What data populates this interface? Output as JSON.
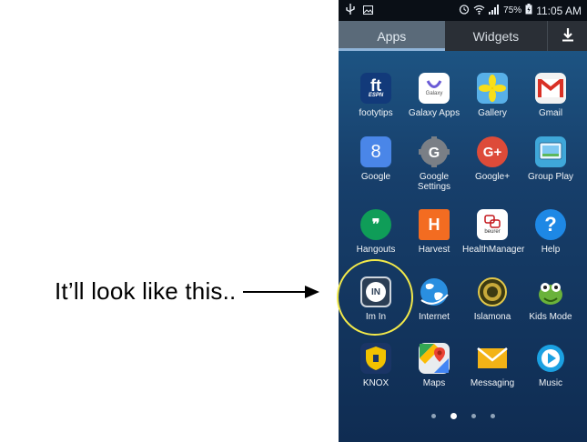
{
  "caption": "It’ll look like this..",
  "status": {
    "battery": "75%",
    "time": "11:05 AM"
  },
  "tabs": {
    "apps": "Apps",
    "widgets": "Widgets"
  },
  "apps": [
    {
      "label": "footytips",
      "icon": "footytips-icon"
    },
    {
      "label": "Galaxy Apps",
      "icon": "galaxy-apps-icon"
    },
    {
      "label": "Gallery",
      "icon": "gallery-icon"
    },
    {
      "label": "Gmail",
      "icon": "gmail-icon"
    },
    {
      "label": "Google",
      "icon": "google-icon"
    },
    {
      "label": "Google Settings",
      "icon": "google-settings-icon"
    },
    {
      "label": "Google+",
      "icon": "google-plus-icon"
    },
    {
      "label": "Group Play",
      "icon": "group-play-icon"
    },
    {
      "label": "Hangouts",
      "icon": "hangouts-icon"
    },
    {
      "label": "Harvest",
      "icon": "harvest-icon"
    },
    {
      "label": "HealthManager",
      "icon": "health-manager-icon"
    },
    {
      "label": "Help",
      "icon": "help-icon"
    },
    {
      "label": "Im In",
      "icon": "im-in-icon"
    },
    {
      "label": "Internet",
      "icon": "internet-icon"
    },
    {
      "label": "Islamona",
      "icon": "islamona-icon"
    },
    {
      "label": "Kids Mode",
      "icon": "kids-mode-icon"
    },
    {
      "label": "KNOX",
      "icon": "knox-icon"
    },
    {
      "label": "Maps",
      "icon": "maps-icon"
    },
    {
      "label": "Messaging",
      "icon": "messaging-icon"
    },
    {
      "label": "Music",
      "icon": "music-icon"
    }
  ],
  "icon_text": {
    "footytips": "ft",
    "footytips_sub": "ESPN",
    "galaxy": "Galaxy",
    "google": "8",
    "gsettings": "G",
    "gplus": "G+",
    "hangouts": "❞",
    "harvest": "H",
    "beurer": "beurer",
    "help": "?",
    "imin": "IN"
  }
}
